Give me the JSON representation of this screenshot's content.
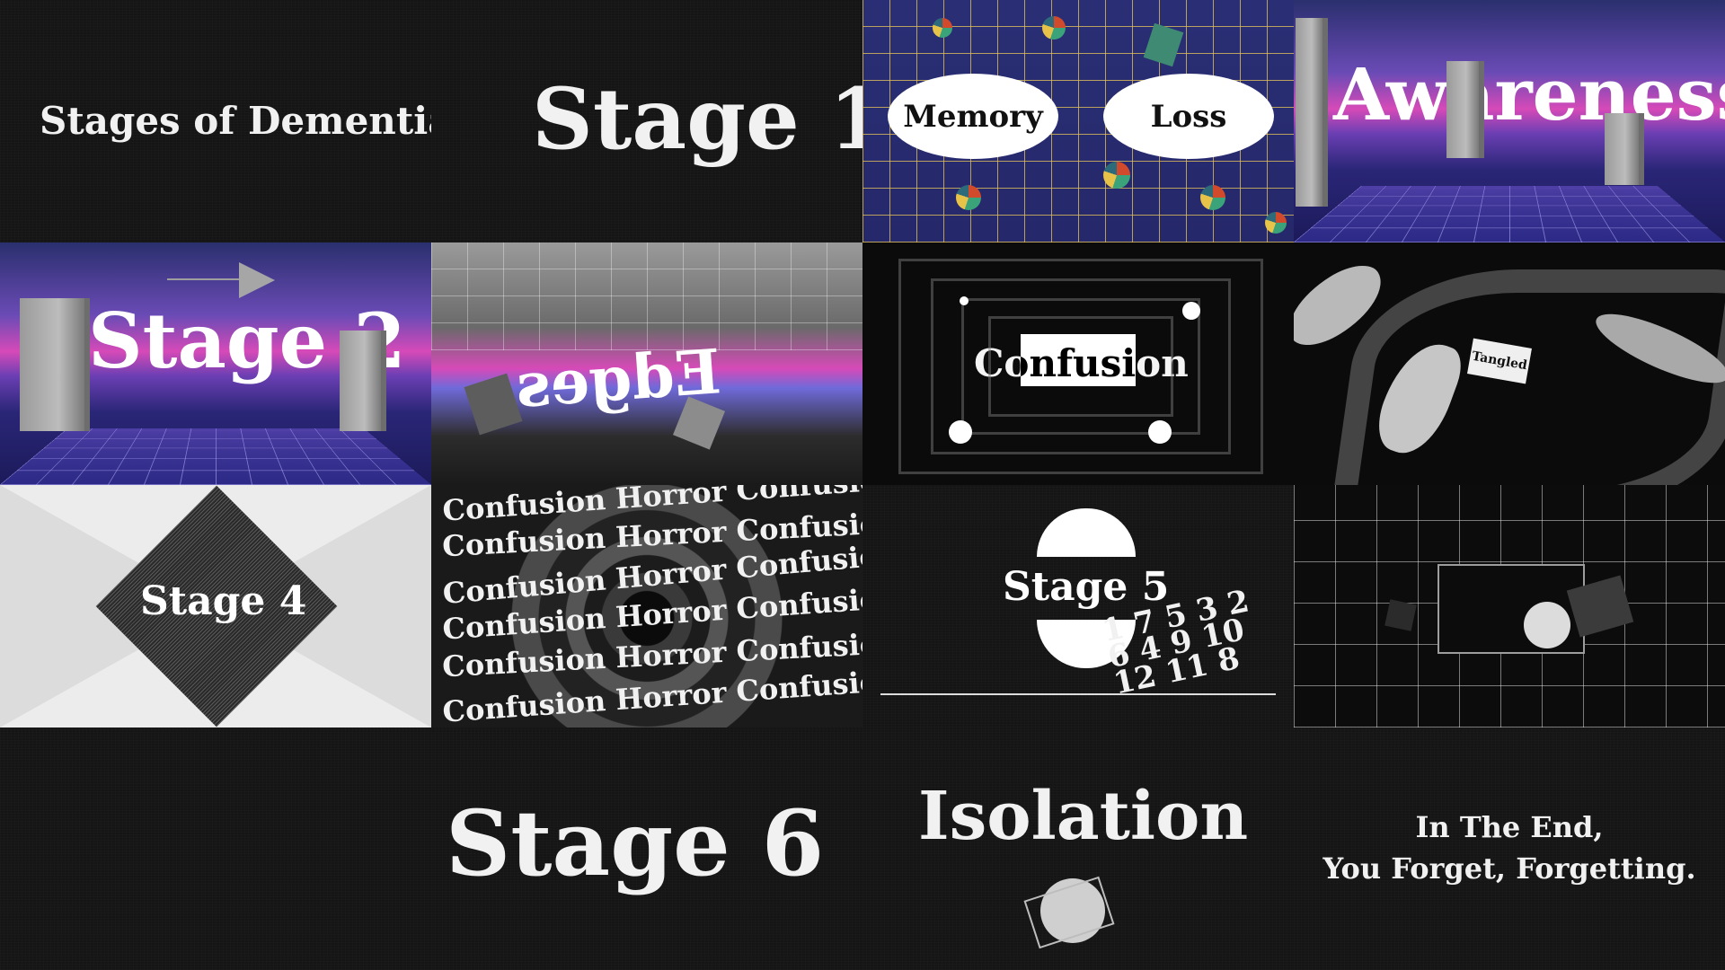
{
  "tiles": {
    "t1": {
      "title": "Stages of Dementia"
    },
    "t2": {
      "title": "Stage 1"
    },
    "t3": {
      "left_word": "Memory",
      "right_word": "Loss"
    },
    "t4": {
      "title": "Awareness"
    },
    "t5": {
      "title": "Stage 2"
    },
    "t6": {
      "title": "Edges"
    },
    "t7": {
      "title": "Confusion"
    },
    "t8": {
      "title": "Tangled"
    },
    "t9": {
      "title": "Stage 4"
    },
    "t10": {
      "rows": [
        "Confusion Horror Confusion",
        "Confusion Horror Confusion",
        "Confusion Horror Confusion",
        "Confusion Horror Confusion",
        "Confusion Horror Confusion",
        "Confusion Horror Confusion"
      ]
    },
    "t11": {
      "title": "Stage 5",
      "numbers": "1 7 5 3 2 6 4 9 10 12 11 8"
    },
    "t12": {},
    "t13": {},
    "t14": {
      "title": "Stage 6"
    },
    "t15": {
      "title": "Isolation"
    },
    "t16": {
      "line1": "In The End,",
      "line2": "You Forget, Forgetting."
    }
  },
  "colors": {
    "dark_bg": "#151515",
    "text_light": "#f1f1f1",
    "synth_pink": "#d64ab8",
    "synth_blue": "#2a2f6e",
    "grid_gold": "#debe5a"
  }
}
